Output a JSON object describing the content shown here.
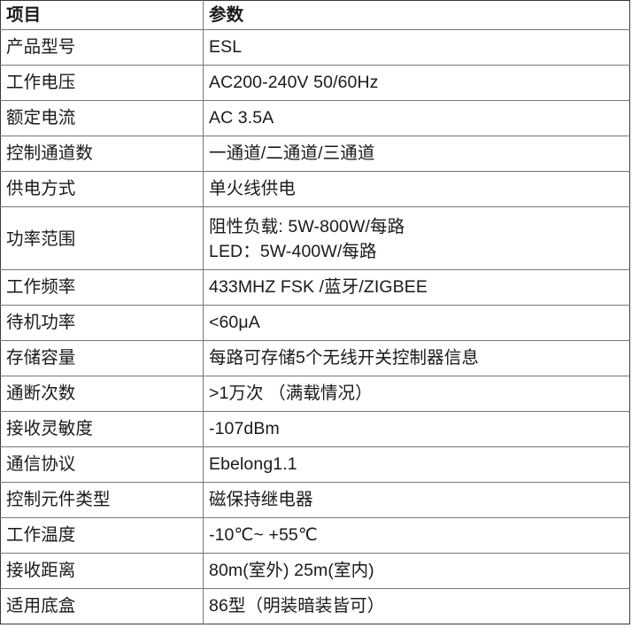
{
  "table": {
    "headers": {
      "item": "项目",
      "parameter": "参数"
    },
    "rows": [
      {
        "item": "产品型号",
        "value": "ESL"
      },
      {
        "item": "工作电压",
        "value": "AC200-240V  50/60Hz"
      },
      {
        "item": "额定电流",
        "value": "AC 3.5A"
      },
      {
        "item": "控制通道数",
        "value": "一通道/二通道/三通道"
      },
      {
        "item": "供电方式",
        "value": "单火线供电"
      },
      {
        "item": "功率范围",
        "value_line1": "阻性负载: 5W-800W/每路",
        "value_line2": "LED：5W-400W/每路"
      },
      {
        "item": "工作频率",
        "value": "433MHZ FSK /蓝牙/ZIGBEE"
      },
      {
        "item": "待机功率",
        "value": "<60μA"
      },
      {
        "item": "存储容量",
        "value": "每路可存储5个无线开关控制器信息"
      },
      {
        "item": "通断次数",
        "value": ">1万次 （满载情况）"
      },
      {
        "item": "接收灵敏度",
        "value": "-107dBm"
      },
      {
        "item": "通信协议",
        "value": "Ebelong1.1"
      },
      {
        "item": "控制元件类型",
        "value": "磁保持继电器"
      },
      {
        "item": "工作温度",
        "value": "-10℃~ +55℃"
      },
      {
        "item": "接收距离",
        "value": "80m(室外) 25m(室内)"
      },
      {
        "item": "适用底盒",
        "value": "86型（明装暗装皆可）"
      }
    ],
    "colors": {
      "outer_border": "#3a3a3a",
      "inner_border": "#777777",
      "text": "#1a1a1a",
      "background": "#ffffff"
    }
  }
}
